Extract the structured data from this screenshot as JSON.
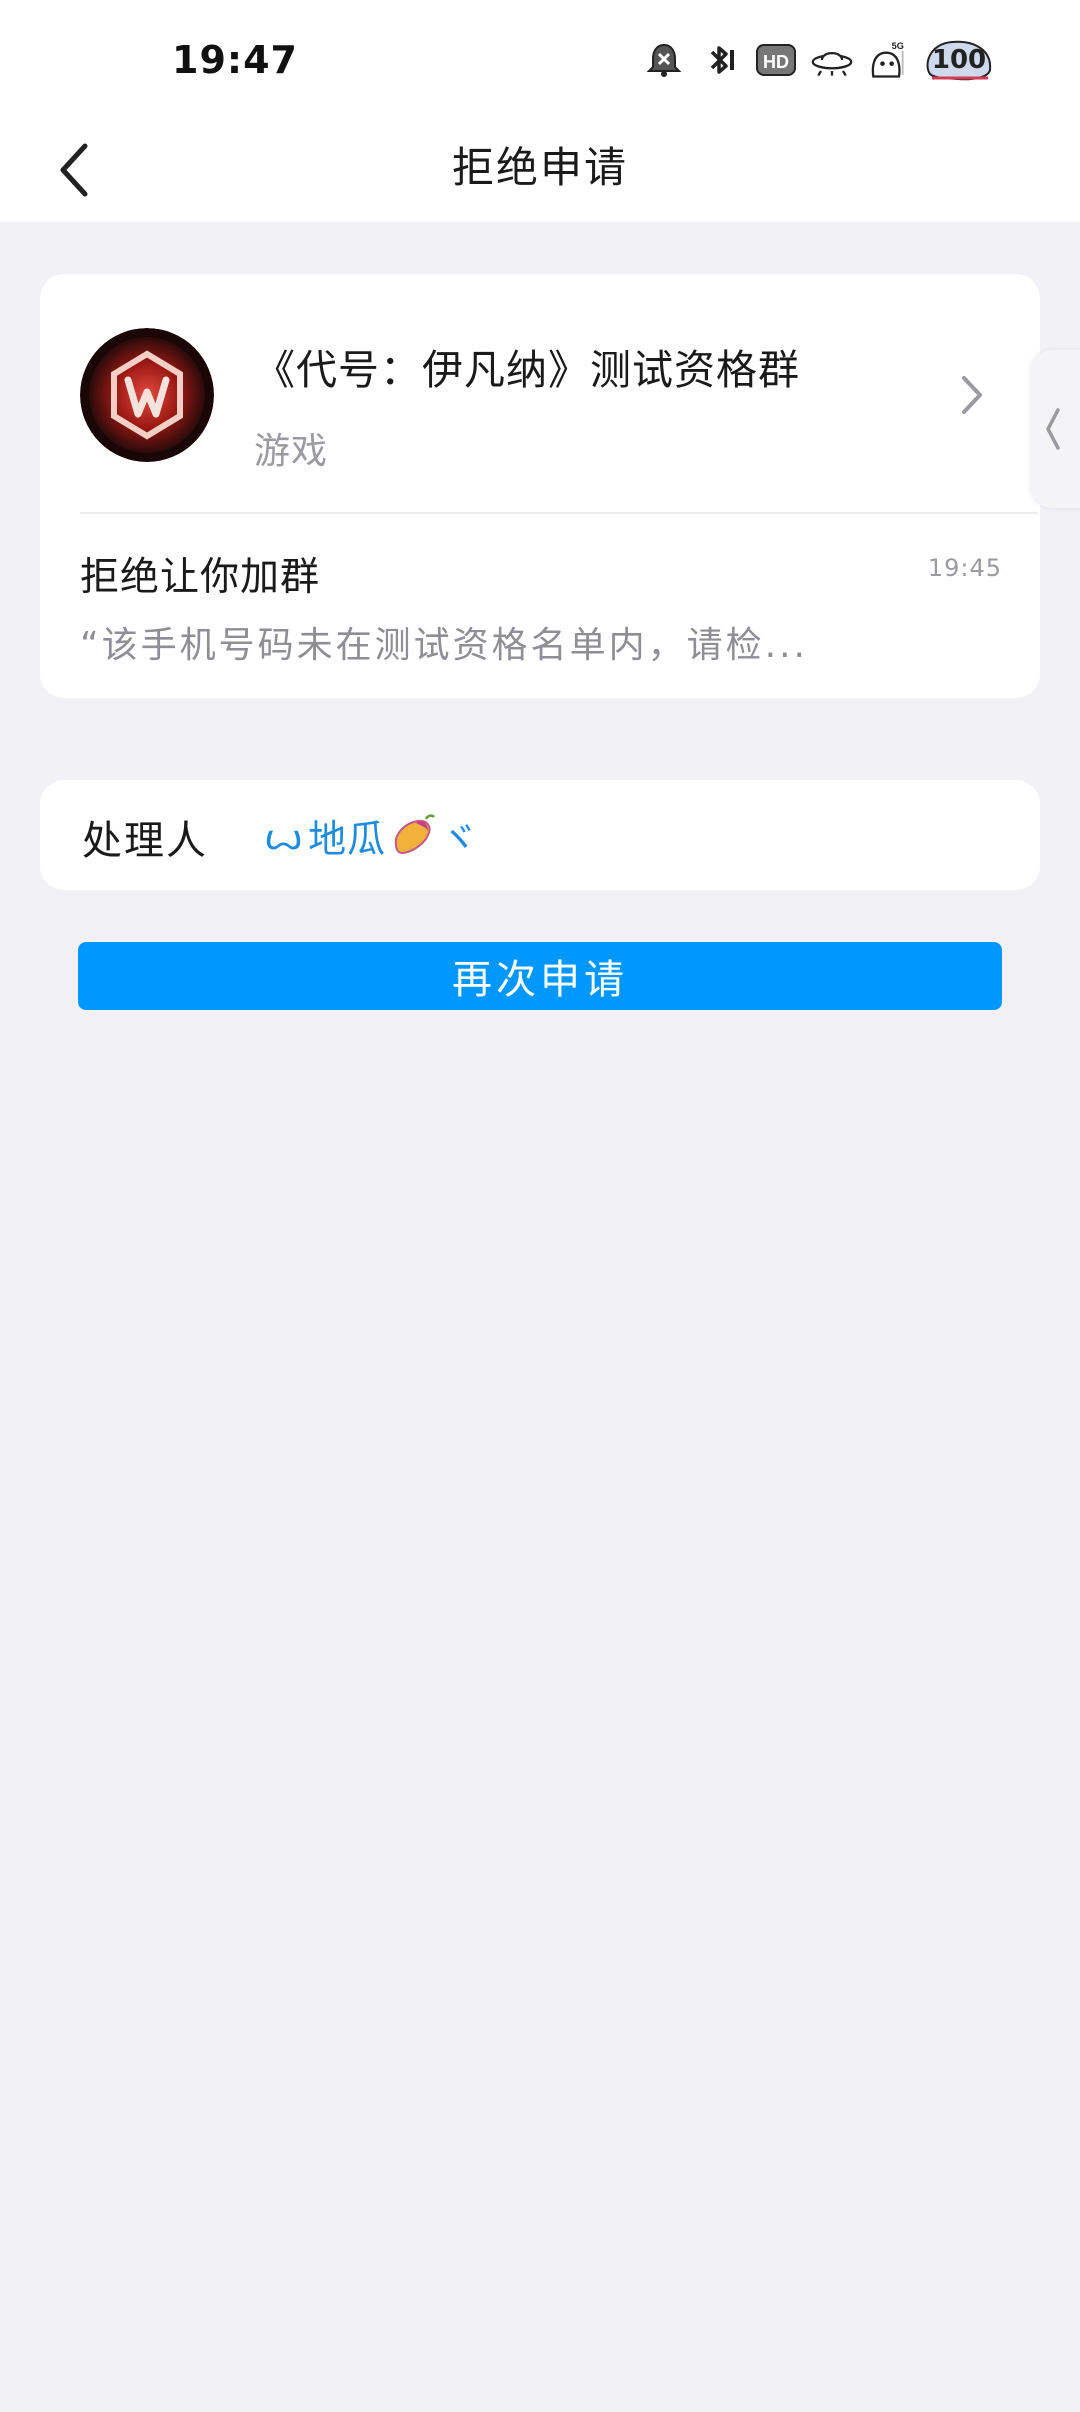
{
  "status_bar": {
    "time": "19:47",
    "battery": "100",
    "network_label": "5G",
    "hd_label": "HD",
    "icons": [
      "alarm-icon",
      "bluetooth-icon",
      "hd-icon",
      "ufo-wifi-icon",
      "cat-signal-icon",
      "battery-icon"
    ]
  },
  "header": {
    "title": "拒绝申请",
    "back_icon": "chevron-left-icon"
  },
  "group": {
    "name": "《代号：伊凡纳》测试资格群",
    "category": "游戏",
    "avatar_colors": [
      "#2a0b0b",
      "#b3201c",
      "#f1d4cb"
    ]
  },
  "rejection": {
    "title": "拒绝让你加群",
    "time": "19:45",
    "message": "“该手机号码未在测试资格名单内，请检..."
  },
  "handler": {
    "label": "处理人",
    "prefix": "ꙍ",
    "name": "地瓜",
    "suffix": "ヾ"
  },
  "actions": {
    "reapply_label": "再次申请"
  },
  "colors": {
    "accent": "#0098ff",
    "handler_link": "#1f8ce0",
    "page_bg": "#f1f1f6",
    "secondary_text": "#9a9aa0"
  }
}
